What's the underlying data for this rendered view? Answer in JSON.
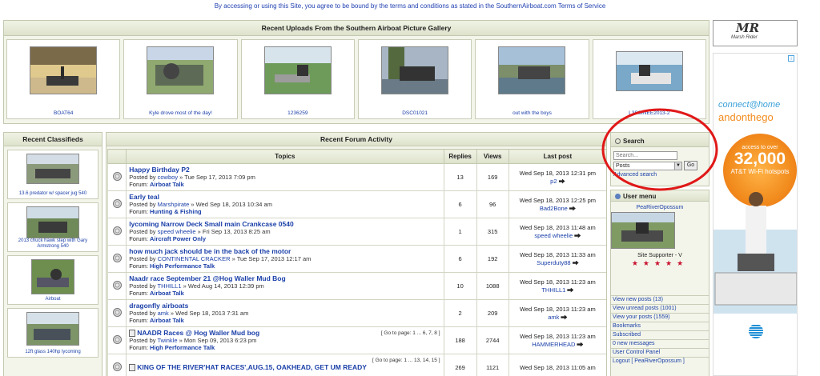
{
  "terms": "By accessing or using this Site, you agree to be bound by the terms and conditions as stated in the SouthernAirboat.com Terms of Service",
  "gallery": {
    "title": "Recent Uploads From the Southern Airboat Picture Gallery",
    "items": [
      {
        "caption": "BOAT64"
      },
      {
        "caption": "Kyle drove most of the day!"
      },
      {
        "caption": "1236259"
      },
      {
        "caption": "DSC01021"
      },
      {
        "caption": "out with the boys"
      },
      {
        "caption": "L3SSINEE2013-2"
      }
    ]
  },
  "classifieds": {
    "title": "Recent Classifieds",
    "items": [
      {
        "caption": "13.6 predator w/ spacer jug 540"
      },
      {
        "caption": "2013 chuck hawk step with Gary Armstrong 540"
      },
      {
        "caption": "Airboat"
      },
      {
        "caption": "12ft glass 140hp lycoming"
      }
    ]
  },
  "forum": {
    "title": "Recent Forum Activity",
    "columns": {
      "topics": "Topics",
      "replies": "Replies",
      "views": "Views",
      "last": "Last post"
    },
    "rows": [
      {
        "title": "Happy Birthday P2",
        "by": "Posted by ",
        "author": "cowboy",
        "date": " » Tue Sep 17, 2013 7:09 pm",
        "forum_label": "Forum: ",
        "forum": "Airboat Talk",
        "replies": "13",
        "views": "169",
        "last_date": "Wed Sep 18, 2013 12:31 pm",
        "last_user": "p2",
        "goto": ""
      },
      {
        "title": "Early teal",
        "by": "Posted by ",
        "author": "Marshpirate",
        "date": " » Wed Sep 18, 2013 10:34 am",
        "forum_label": "Forum: ",
        "forum": "Hunting & Fishing",
        "replies": "6",
        "views": "96",
        "last_date": "Wed Sep 18, 2013 12:25 pm",
        "last_user": "Bad2Bone",
        "goto": ""
      },
      {
        "title": "lycoming Narrow Deck Small main Crankcase 0540",
        "by": "Posted by ",
        "author": "speed wheelie",
        "date": " » Fri Sep 13, 2013 8:25 am",
        "forum_label": "Forum: ",
        "forum": "Aircraft Power Only",
        "replies": "1",
        "views": "315",
        "last_date": "Wed Sep 18, 2013 11:48 am",
        "last_user": "speed wheelie",
        "goto": ""
      },
      {
        "title": "how much jack should be in the back of the motor",
        "by": "Posted by ",
        "author": "CONTINENTAL CRACKER",
        "date": " » Tue Sep 17, 2013 12:17 am",
        "forum_label": "Forum: ",
        "forum": "High Performance Talk",
        "replies": "6",
        "views": "192",
        "last_date": "Wed Sep 18, 2013 11:33 am",
        "last_user": "Superduty88",
        "goto": ""
      },
      {
        "title": "Naadr race September 21 @Hog Waller Mud Bog",
        "by": "Posted by ",
        "author": "THHILL1",
        "date": " » Wed Aug 14, 2013 12:39 pm",
        "forum_label": "Forum: ",
        "forum": "Airboat Talk",
        "replies": "10",
        "views": "1088",
        "last_date": "Wed Sep 18, 2013 11:23 am",
        "last_user": "THHILL1",
        "goto": ""
      },
      {
        "title": "dragonfly airboats",
        "by": "Posted by ",
        "author": "amk",
        "date": " » Wed Sep 18, 2013 7:31 am",
        "forum_label": "Forum: ",
        "forum": "Airboat Talk",
        "replies": "2",
        "views": "209",
        "last_date": "Wed Sep 18, 2013 11:23 am",
        "last_user": "amk",
        "goto": ""
      },
      {
        "title": "NAADR Races @ Hog Waller Mud bog",
        "by": "Posted by ",
        "author": "Twinkle",
        "date": " » Mon Sep 09, 2013 6:23 pm",
        "forum_label": "Forum: ",
        "forum": "High Performance Talk",
        "replies": "188",
        "views": "2744",
        "last_date": "Wed Sep 18, 2013 11:23 am",
        "last_user": "HAMMERHEAD",
        "goto": "[ Go to page: 1 ... 6, 7, 8 ]"
      },
      {
        "title": "KING OF THE RIVER'HAT RACES',AUG.15, OAKHEAD, GET UM READY",
        "by": "",
        "author": "",
        "date": "",
        "forum_label": "",
        "forum": "",
        "replies": "269",
        "views": "1121",
        "last_date": "Wed Sep 18, 2013 11:05 am",
        "last_user": "",
        "goto": "[ Go to page: 1 ... 13, 14, 15 ]"
      }
    ]
  },
  "search": {
    "title": "Search",
    "placeholder": "Search...",
    "scope": "Posts",
    "go": "Go",
    "advanced": "Advanced search"
  },
  "user_menu": {
    "title": "User menu",
    "username": "PeaRiverOpossum",
    "rank": "Site Supporter - V",
    "stars": "★★★★★",
    "links": [
      "View new posts (13)",
      "View unread posts (1001)",
      "View your posts (1559)",
      "Bookmarks",
      "Subscribed",
      "0 new messages",
      "User Control Panel",
      "Logout [ PeaRiverOpossum ]"
    ]
  },
  "ads": {
    "logo_text": "MR",
    "logo_sub": "Marsh Rider",
    "line1": "connect@home",
    "line2": "andonthego",
    "burst1": "access to over",
    "burst2": "32,000",
    "burst3": "AT&T Wi-Fi hotspots",
    "info": "i"
  }
}
